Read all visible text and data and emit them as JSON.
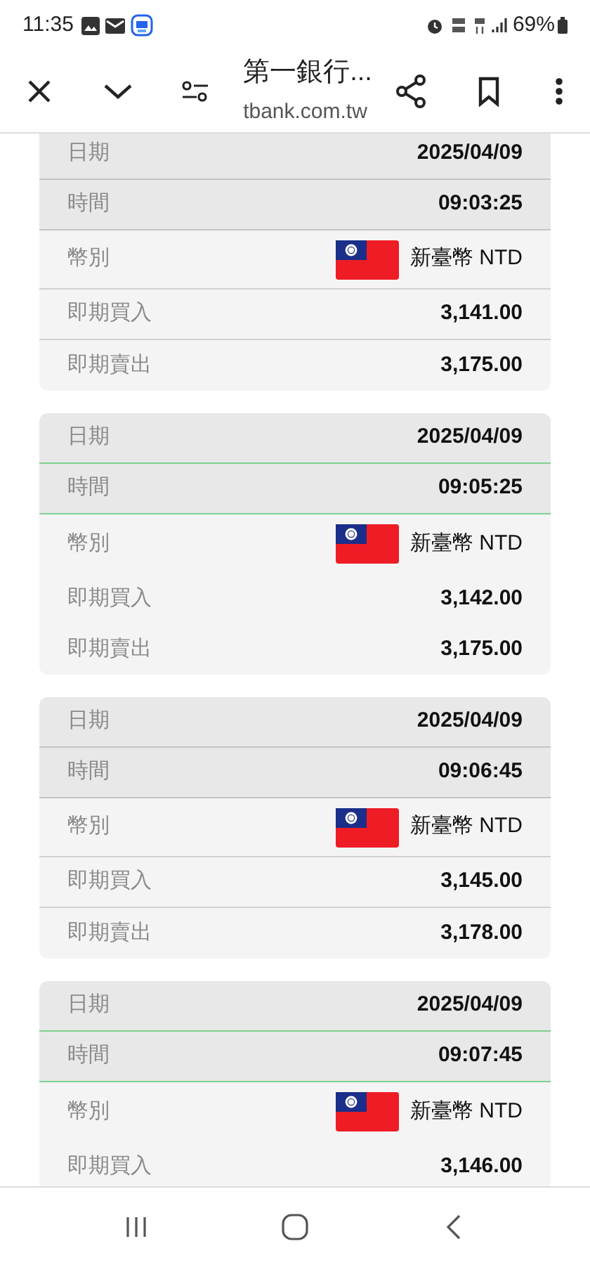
{
  "status_bar": {
    "time": "11:35",
    "battery": "69%"
  },
  "toolbar": {
    "title": "第一銀行...",
    "url": "tbank.com.tw"
  },
  "cards": [
    {
      "highlighted": false,
      "rows": [
        {
          "kind": "header",
          "label": "日期",
          "value": "2025/04/09"
        },
        {
          "kind": "header",
          "label": "時間",
          "value": "09:03:25"
        },
        {
          "kind": "currency",
          "label": "幣別",
          "value": "新臺幣 NTD"
        },
        {
          "kind": "body",
          "label": "即期買入",
          "value": "3,141.00"
        },
        {
          "kind": "body",
          "label": "即期賣出",
          "value": "3,175.00"
        }
      ]
    },
    {
      "highlighted": true,
      "rows": [
        {
          "kind": "header",
          "label": "日期",
          "value": "2025/04/09"
        },
        {
          "kind": "header",
          "label": "時間",
          "value": "09:05:25"
        },
        {
          "kind": "currency",
          "label": "幣別",
          "value": "新臺幣 NTD"
        },
        {
          "kind": "body",
          "label": "即期買入",
          "value": "3,142.00"
        },
        {
          "kind": "body",
          "label": "即期賣出",
          "value": "3,175.00"
        }
      ]
    },
    {
      "highlighted": false,
      "rows": [
        {
          "kind": "header",
          "label": "日期",
          "value": "2025/04/09"
        },
        {
          "kind": "header",
          "label": "時間",
          "value": "09:06:45"
        },
        {
          "kind": "currency",
          "label": "幣別",
          "value": "新臺幣 NTD"
        },
        {
          "kind": "body",
          "label": "即期買入",
          "value": "3,145.00"
        },
        {
          "kind": "body",
          "label": "即期賣出",
          "value": "3,178.00"
        }
      ]
    },
    {
      "highlighted": true,
      "rows": [
        {
          "kind": "header",
          "label": "日期",
          "value": "2025/04/09"
        },
        {
          "kind": "header",
          "label": "時間",
          "value": "09:07:45"
        },
        {
          "kind": "currency",
          "label": "幣別",
          "value": "新臺幣 NTD"
        },
        {
          "kind": "body",
          "label": "即期買入",
          "value": "3,146.00"
        }
      ]
    }
  ]
}
